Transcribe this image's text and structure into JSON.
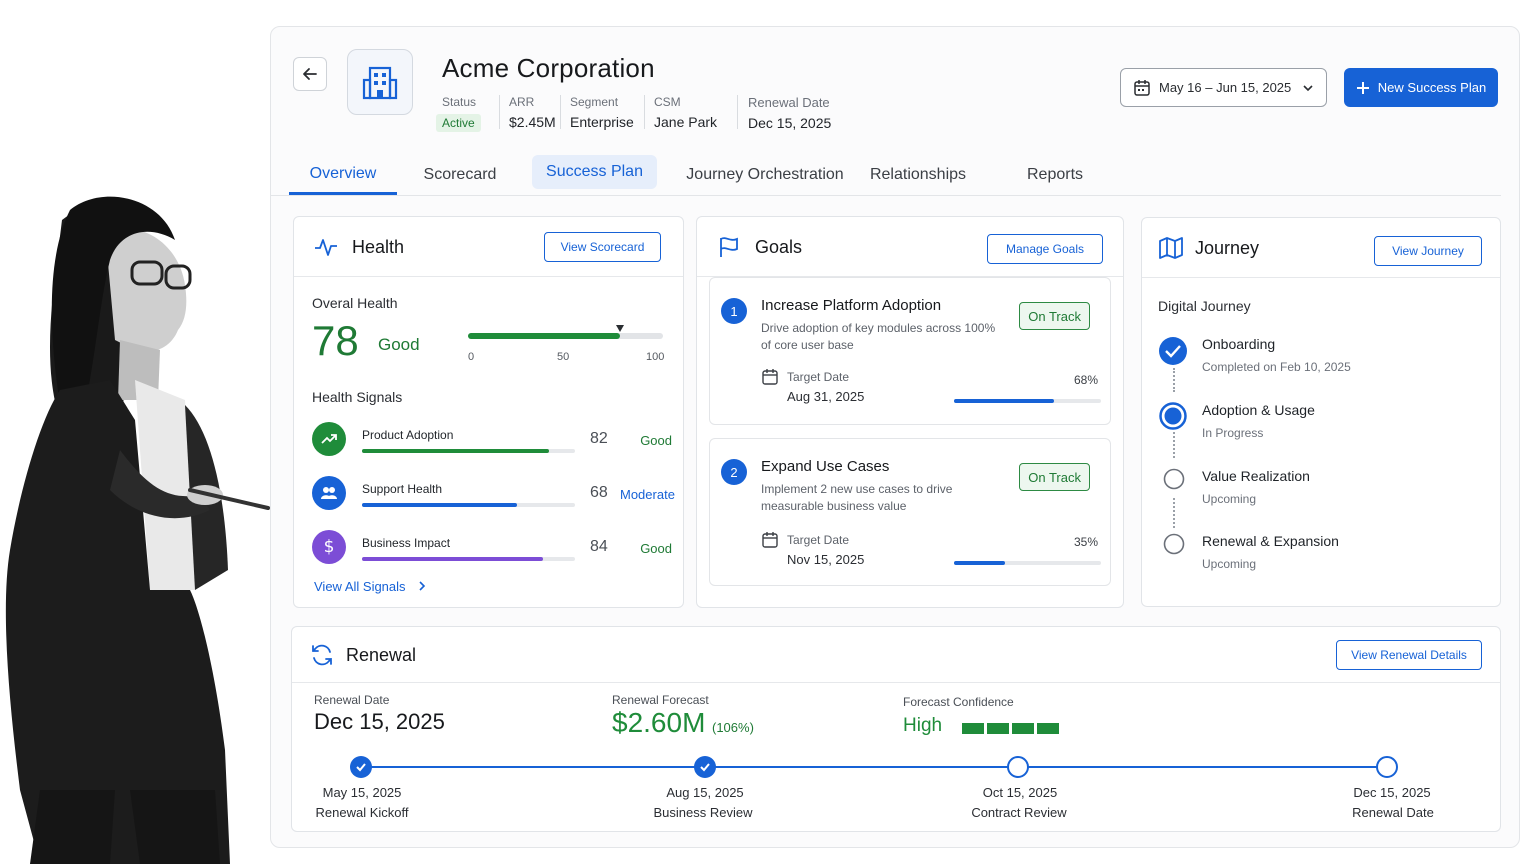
{
  "header": {
    "company_name": "Acme Corporation",
    "meta": [
      {
        "label": "Status",
        "value": "Active"
      },
      {
        "label": "ARR",
        "value": "$2.45M"
      },
      {
        "label": "Segment",
        "value": "Enterprise"
      },
      {
        "label": "CSM",
        "value": "Jane Park"
      },
      {
        "label": "Renewal Date",
        "value": "Dec 15, 2025"
      }
    ],
    "date_range": "May 16  –  Jun 15, 2025",
    "new_plan_label": "New Success Plan"
  },
  "tabs": [
    "Overview",
    "Scorecard",
    "Success Plan",
    "Journey Orchestration",
    "Relationships",
    "Reports"
  ],
  "health": {
    "title": "Health",
    "button": "View Scorecard",
    "overall_label": "Overal Health",
    "score": "78",
    "score_label": "Good",
    "gauge_value": 78,
    "gauge_ticks": [
      "0",
      "50",
      "100"
    ],
    "signals_title": "Health Signals",
    "signals": [
      {
        "name": "Product Adoption",
        "value": "82",
        "status": "Good",
        "fill": 0.88,
        "color": "#1f8c3a",
        "status_color": "#1f7a35",
        "icon": "trending-up-icon"
      },
      {
        "name": "Support Health",
        "value": "68",
        "status": "Moderate",
        "fill": 0.73,
        "color": "#1762d6",
        "status_color": "#1762d6",
        "icon": "users-icon"
      },
      {
        "name": "Business Impact",
        "value": "84",
        "status": "Good",
        "fill": 0.85,
        "color": "#7c4dd6",
        "status_color": "#1f7a35",
        "icon": "dollar-icon"
      }
    ],
    "view_all": "View All Signals"
  },
  "goals": {
    "title": "Goals",
    "button": "Manage Goals",
    "items": [
      {
        "num": "1",
        "title": "Increase Platform Adoption",
        "desc": "Drive adoption of key modules across 100% of core user base",
        "status": "On Track",
        "target_label": "Target Date",
        "target_date": "Aug 31, 2025",
        "pct": "68%",
        "progress": 0.68
      },
      {
        "num": "2",
        "title": "Expand Use Cases",
        "desc": "Implement 2 new use cases to drive measurable business value",
        "status": "On Track",
        "target_label": "Target Date",
        "target_date": "Nov 15, 2025",
        "pct": "35%",
        "progress": 0.35
      }
    ]
  },
  "journey": {
    "title": "Journey",
    "button": "View Journey",
    "subtitle": "Digital Journey",
    "steps": [
      {
        "name": "Onboarding",
        "sub": "Completed on Feb 10, 2025",
        "state": "done"
      },
      {
        "name": "Adoption & Usage",
        "sub": "In Progress",
        "state": "current"
      },
      {
        "name": "Value Realization",
        "sub": "Upcoming",
        "state": "upcoming"
      },
      {
        "name": "Renewal & Expansion",
        "sub": "Upcoming",
        "state": "upcoming"
      }
    ]
  },
  "renewal": {
    "title": "Renewal",
    "button": "View Renewal Details",
    "date_label": "Renewal Date",
    "date": "Dec 15, 2025",
    "forecast_label": "Renewal Forecast",
    "forecast": "$2.60M",
    "forecast_pct": "(106%)",
    "confidence_label": "Forecast Confidence",
    "confidence": "High",
    "confidence_level": 4,
    "milestones": [
      {
        "date": "May 15, 2025",
        "name": "Renewal Kickoff",
        "done": true
      },
      {
        "date": "Aug 15, 2025",
        "name": "Business Review",
        "done": true
      },
      {
        "date": "Oct 15, 2025",
        "name": "Contract Review",
        "done": false
      },
      {
        "date": "Dec 15, 2025",
        "name": "Renewal Date",
        "done": false
      }
    ]
  },
  "colors": {
    "accent": "#1762d6",
    "good": "#1f8c3a",
    "purple": "#7c4dd6"
  }
}
